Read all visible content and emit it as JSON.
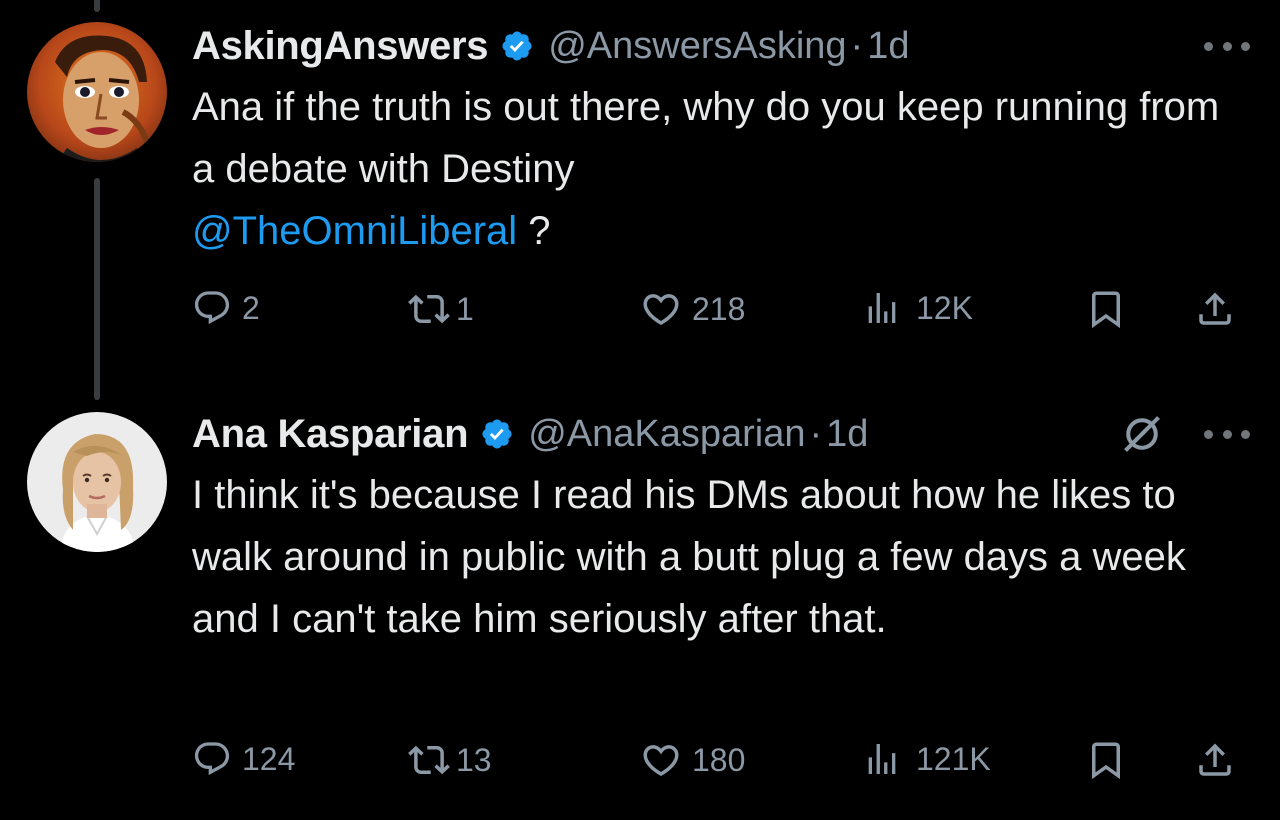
{
  "tweets": [
    {
      "display_name": "AskingAnswers",
      "handle": "@AnswersAsking",
      "separator": "·",
      "time": "1d",
      "text_before_mention": "Ana if the truth is out there, why do you keep running from a debate with Destiny",
      "mention": "@TheOmniLiberal",
      "text_after_mention": " ?",
      "stats": {
        "replies": "2",
        "reposts": "1",
        "likes": "218",
        "views": "12K"
      }
    },
    {
      "display_name": "Ana Kasparian",
      "handle": "@AnaKasparian",
      "separator": "·",
      "time": "1d",
      "text": "I think it's because I read his DMs about how he likes to walk around in public with a butt plug a few days a week and I can't take him seriously after that.",
      "stats": {
        "replies": "124",
        "reposts": "13",
        "likes": "180",
        "views": "121K"
      }
    }
  ],
  "colors": {
    "background": "#000000",
    "text": "#e7e9ea",
    "secondary": "#8b98a5",
    "accent": "#1d9bf0",
    "thread_line": "#3a3d40"
  },
  "icons": [
    "verified-badge-icon",
    "more-icon",
    "grok-icon",
    "reply-icon",
    "repost-icon",
    "like-icon",
    "views-icon",
    "bookmark-icon",
    "share-icon"
  ]
}
